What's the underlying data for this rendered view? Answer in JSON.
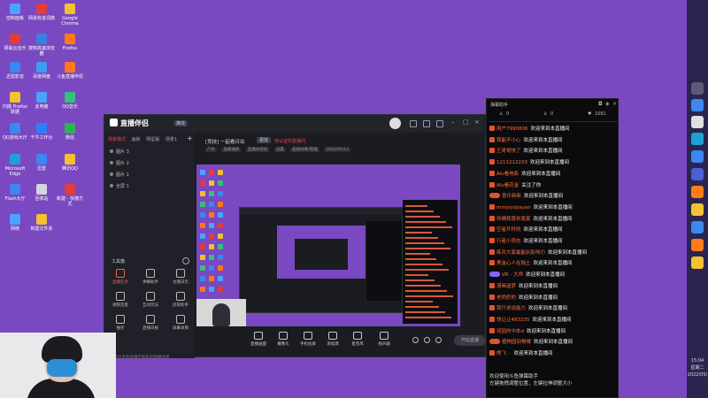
{
  "desktop": {
    "icons": [
      {
        "label": "控制面板",
        "color": "#4aa3ff"
      },
      {
        "label": "网易有道词典",
        "color": "#e33c3c"
      },
      {
        "label": "Google Chrome",
        "color": "#f2c230"
      },
      {
        "label": "网易云音乐",
        "color": "#e33c3c"
      },
      {
        "label": "搜狗高速浏览器",
        "color": "#3a7fe0"
      },
      {
        "label": "Firefox",
        "color": "#ff7a1a"
      },
      {
        "label": "迅雷影音",
        "color": "#3b88f0"
      },
      {
        "label": "百度网盘",
        "color": "#3b9ff0"
      },
      {
        "label": "斗鱼直播伴侣",
        "color": "#ff7a1a"
      },
      {
        "label": "扫描 Firefox 数据",
        "color": "#f2c230"
      },
      {
        "label": "此电脑",
        "color": "#4aa3ff"
      },
      {
        "label": "QQ音乐",
        "color": "#31c27c"
      },
      {
        "label": "QQ游戏大厅",
        "color": "#3b88f0"
      },
      {
        "label": "千牛工作台",
        "color": "#2d7ff9"
      },
      {
        "label": "微信",
        "color": "#2ab54f"
      },
      {
        "label": "Microsoft Edge",
        "color": "#1fa0d6"
      },
      {
        "label": "迅雷",
        "color": "#3b88f0"
      },
      {
        "label": "腾讯QQ",
        "color": "#f2c230"
      },
      {
        "label": "Flash大厅",
        "color": "#3b88f0"
      },
      {
        "label": "回收站",
        "color": "#cfd6e0"
      },
      {
        "label": "新建 - 快捷方式",
        "color": "#e33c3c"
      },
      {
        "label": "网络",
        "color": "#4aa3ff"
      },
      {
        "label": "新建文件夹",
        "color": "#f2c230"
      }
    ]
  },
  "app": {
    "title": "直播伴侣",
    "badge": "离线",
    "scene_tabs": [
      "场景模式",
      "画板",
      "明星版",
      "场景1"
    ],
    "scenes": [
      "图片 3",
      "图片 2",
      "图片 1",
      "全屏 1"
    ],
    "tools_title": "工具箱",
    "tools": [
      {
        "label": "直播任务",
        "hot": true
      },
      {
        "label": "弹幕助手",
        "hot": false
      },
      {
        "label": "主播日历",
        "hot": false
      },
      {
        "label": "视频连麦",
        "hot": false
      },
      {
        "label": "互动玩法",
        "hot": false
      },
      {
        "label": "房管助手",
        "hot": false
      },
      {
        "label": "抽奖",
        "hot": false
      },
      {
        "label": "直播日报",
        "hot": false
      },
      {
        "label": "屏幕录像",
        "hot": false
      }
    ],
    "room": {
      "title": "[竞技] 一起看日出",
      "tag": "更改",
      "warning": "待认证的直播间",
      "subtags": [
        "户外",
        "直播通知",
        "直播间装扮",
        "设置",
        "超级勋章/管理",
        "2022/05/12"
      ]
    },
    "bottom_bar": [
      {
        "label": "直播画面"
      },
      {
        "label": "摄像头"
      },
      {
        "label": "手机投屏"
      },
      {
        "label": "添加源"
      },
      {
        "label": "麦克风"
      },
      {
        "label": "扬声器"
      }
    ],
    "start_button": "开始直播",
    "notice": "您开启手机直播可能影响弹幕效果"
  },
  "chat": {
    "title": "弹幕助手",
    "stats": {
      "viewers": "0",
      "fans": "0",
      "likes": "1581"
    },
    "messages": [
      {
        "name": "用户7990806",
        "msg": "欢迎来到本直播间"
      },
      {
        "name": "我能不小心",
        "msg": "欢迎来到本直播间"
      },
      {
        "name": "王哥哥快了",
        "msg": "欢迎来到本直播间"
      },
      {
        "name": "1211212233",
        "msg": "欢迎来到本直播间"
      },
      {
        "name": "Alu看电影",
        "msg": "欢迎来到本直播间"
      },
      {
        "name": "Alu看花金",
        "msg": "关注了你"
      },
      {
        "name": "喜乐新新",
        "msg": "欢迎来到本直播间"
      },
      {
        "name": "mmjoyojiayan",
        "msg": "欢迎来到本直播间"
      },
      {
        "name": "你确我喜欢笔家",
        "msg": "欢迎来到本直播间"
      },
      {
        "name": "空者开杯的",
        "msg": "欢迎来到本直播间"
      },
      {
        "name": "行者小同志",
        "msg": "欢迎来到本直播间"
      },
      {
        "name": "练兵大家最能玩影响力",
        "msg": "欢迎来到本直播间"
      },
      {
        "name": "黑金心人在独土",
        "msg": "欢迎来到本直播间"
      },
      {
        "name": "VR - 大师",
        "msg": "欢迎来到本直播间"
      },
      {
        "name": "漫画追梦",
        "msg": "欢迎来到本直播间"
      },
      {
        "name": "老奶奶的",
        "msg": "欢迎来到本直播间"
      },
      {
        "name": "我只说说能力",
        "msg": "欢迎来到本直播间"
      },
      {
        "name": "快让让483235",
        "msg": "欢迎来到本直播间"
      },
      {
        "name": "班因的中本d",
        "msg": "欢迎来到本直播间"
      },
      {
        "name": "植物园间骨楼",
        "msg": "欢迎来到本直播间"
      },
      {
        "name": "熊飞 - ",
        "msg": "欢迎来到本直播间"
      }
    ],
    "footer_line1": "欢迎使用斗鱼弹幕助手",
    "footer_line2": "左键拖拽调整位置，左键拉伸调整大小"
  },
  "taskbar": {
    "time": "15:04",
    "weekday": "星期二",
    "date": "2022/05/"
  }
}
